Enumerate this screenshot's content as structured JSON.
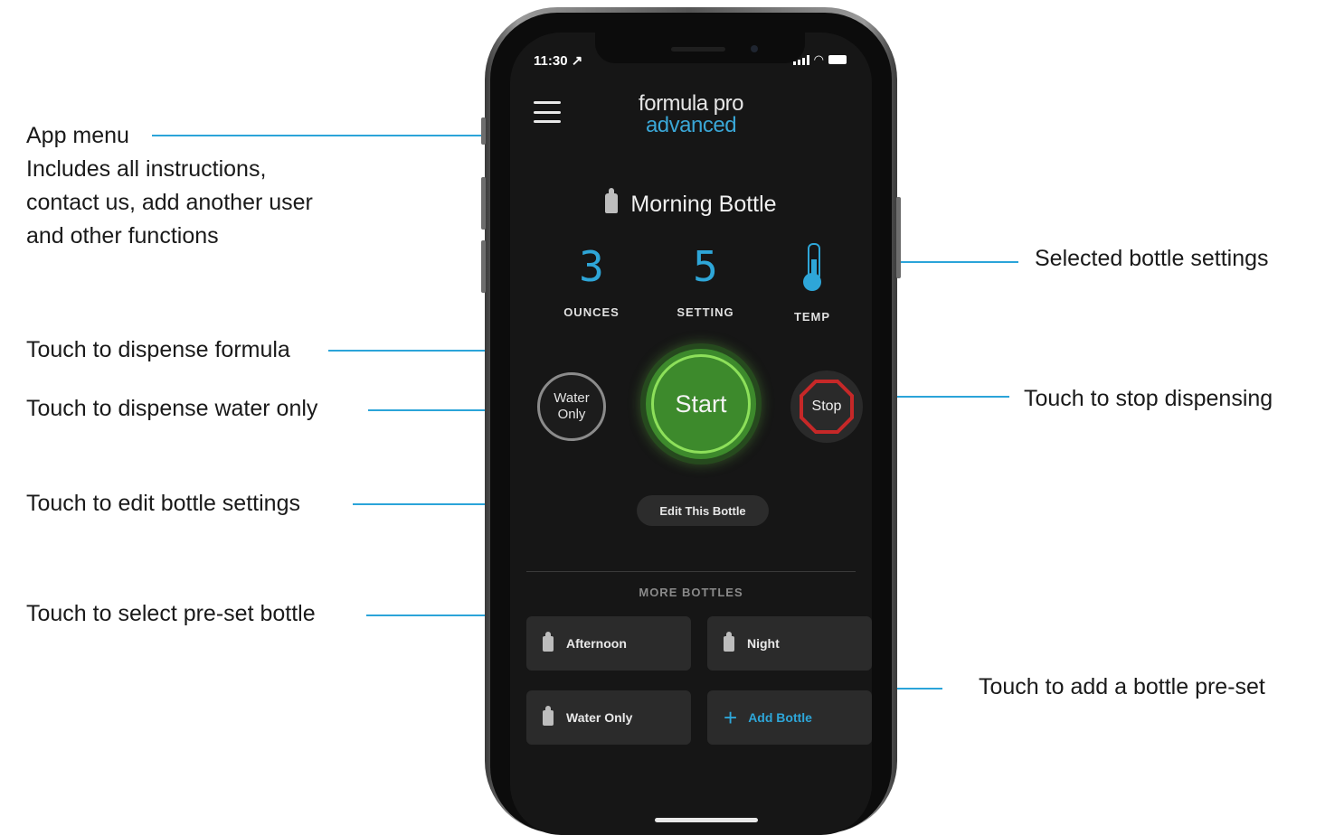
{
  "annotations": {
    "app_menu_title": "App menu",
    "app_menu_desc_1": "Includes all instructions,",
    "app_menu_desc_2": "contact us, add another user",
    "app_menu_desc_3": "and other functions",
    "dispense_formula": "Touch to dispense formula",
    "dispense_water": "Touch to dispense water only",
    "edit_settings": "Touch to edit bottle settings",
    "select_preset": "Touch to select pre-set bottle",
    "selected_settings": "Selected bottle settings",
    "stop_dispensing": "Touch to stop dispensing",
    "add_preset": "Touch to add a bottle pre-set"
  },
  "status_bar": {
    "time": "11:30 ↗"
  },
  "logo": {
    "line1": "formula pro",
    "line2": "advanced"
  },
  "bottle": {
    "name": "Morning Bottle",
    "ounces_value": "3",
    "ounces_label": "OUNCES",
    "setting_value": "5",
    "setting_label": "SETTING",
    "temp_label": "TEMP"
  },
  "actions": {
    "water_only_line1": "Water",
    "water_only_line2": "Only",
    "start": "Start",
    "stop": "Stop",
    "edit": "Edit This Bottle"
  },
  "more_bottles": {
    "title": "MORE BOTTLES",
    "items": [
      {
        "label": "Afternoon"
      },
      {
        "label": "Night"
      },
      {
        "label": "Water Only"
      },
      {
        "label": "Add Bottle"
      }
    ]
  },
  "colors": {
    "accent": "#2ba4d9",
    "start_green": "#3d8a2c",
    "stop_red": "#c62828",
    "screen_bg": "#161616"
  }
}
